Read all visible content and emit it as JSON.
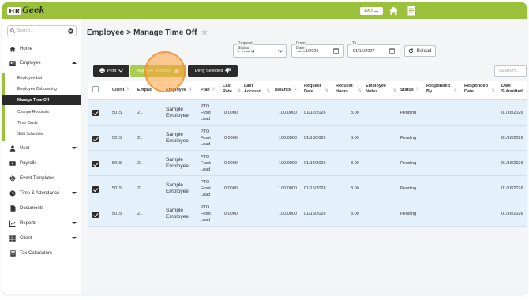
{
  "app": {
    "logo_prefix": "HR",
    "logo_suffix": "Geek",
    "exit_label": "EXIT"
  },
  "sidebar": {
    "search_placeholder": "Search...",
    "items": [
      {
        "label": "Home",
        "icon": "home-icon"
      },
      {
        "label": "Employee",
        "icon": "id-card-icon"
      }
    ],
    "employee_subitems": [
      {
        "label": "Employee List"
      },
      {
        "label": "Employee Onboarding"
      },
      {
        "label": "Manage Time Off",
        "active": true
      },
      {
        "label": "Change Requests"
      },
      {
        "label": "Time Cards"
      },
      {
        "label": "Shift Scheduler"
      }
    ],
    "lower_items": [
      {
        "label": "User",
        "icon": "user-icon",
        "expandable": true
      },
      {
        "label": "Payrolls",
        "icon": "money-icon",
        "expandable": false
      },
      {
        "label": "Event Templates",
        "icon": "gear-icon",
        "expandable": false
      },
      {
        "label": "Time & Attendance",
        "icon": "clock-icon",
        "expandable": true
      },
      {
        "label": "Documents",
        "icon": "document-icon",
        "expandable": false
      },
      {
        "label": "Reports",
        "icon": "chart-icon",
        "expandable": true
      },
      {
        "label": "Client",
        "icon": "grid-icon",
        "expandable": true
      },
      {
        "label": "Tax Calculators",
        "icon": "calculator-icon",
        "expandable": false
      }
    ]
  },
  "header": {
    "breadcrumb_parent": "Employee",
    "breadcrumb_sep": ">",
    "title": "Manage Time Off"
  },
  "filters": {
    "status_label": "Request Status",
    "status_value": "Pending",
    "from_label": "From Date",
    "from_value": "12/01/2025",
    "to_label": "To",
    "to_value": "01/16/2027",
    "reload_label": "Reload"
  },
  "toolbar": {
    "print_label": "Print",
    "approve_label": "Approve Selected",
    "deny_label": "Deny Selected",
    "search_placeholder": "SEARCH..."
  },
  "table": {
    "columns": [
      "Client",
      "EmpNo",
      "Employee",
      "Plan",
      "Last Rate",
      "Last Accrued",
      "Balance",
      "Request Date",
      "Request Hours",
      "Employee Notes",
      "Status",
      "Responded By",
      "Responded Date",
      "Date Submitted"
    ],
    "rows": [
      {
        "client": "5015",
        "empno": "21",
        "employee": "Sample Employee",
        "plan": "PTO Front Load",
        "last_rate": "0.0000",
        "balance": "100.0000",
        "request_date": "01/12/2026",
        "hours": "8.00",
        "status": "Pending",
        "submitted": "01/16/2026"
      },
      {
        "client": "5015",
        "empno": "21",
        "employee": "Sample Employee",
        "plan": "PTO Front Load",
        "last_rate": "0.0000",
        "balance": "100.0000",
        "request_date": "01/13/2026",
        "hours": "8.00",
        "status": "Pending",
        "submitted": "01/16/2026"
      },
      {
        "client": "5015",
        "empno": "21",
        "employee": "Sample Employee",
        "plan": "PTO Front Load",
        "last_rate": "0.0000",
        "balance": "100.0000",
        "request_date": "01/14/2026",
        "hours": "8.00",
        "status": "Pending",
        "submitted": "01/16/2026"
      },
      {
        "client": "5015",
        "empno": "21",
        "employee": "Sample Employee",
        "plan": "PTO Front Load",
        "last_rate": "0.0000",
        "balance": "100.0000",
        "request_date": "01/15/2026",
        "hours": "8.00",
        "status": "Pending",
        "submitted": "01/16/2026"
      },
      {
        "client": "5015",
        "empno": "21",
        "employee": "Sample Employee",
        "plan": "PTO Front Load",
        "last_rate": "0.0000",
        "balance": "100.0000",
        "request_date": "01/16/2026",
        "hours": "8.00",
        "status": "Pending",
        "submitted": "01/16/2026"
      }
    ]
  },
  "colors": {
    "brand_green": "#9bc13c",
    "dark": "#2b2b2b",
    "row_selected": "#e4f0fa",
    "click_highlight": "#ffa03c"
  }
}
